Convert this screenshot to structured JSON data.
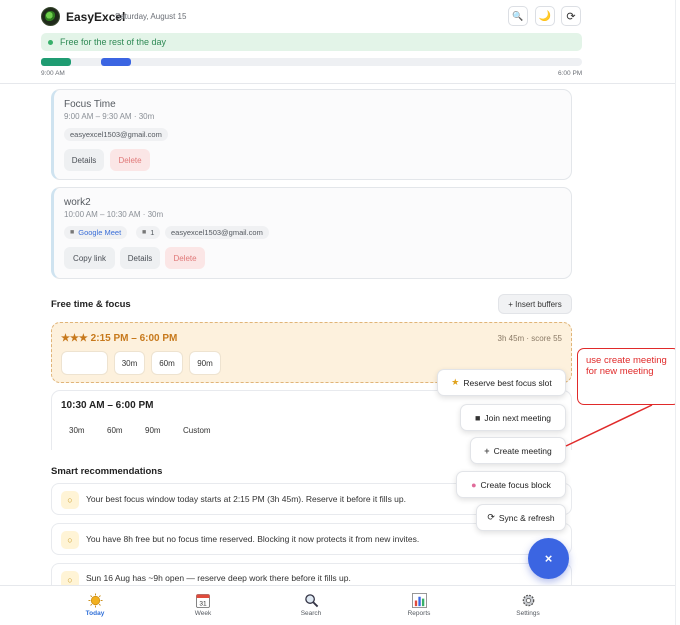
{
  "header": {
    "title": "EasyExcel",
    "date": "Saturday, August 15",
    "buttons": {
      "search_icon": "🔍",
      "theme_icon": "🌙",
      "refresh_icon": "⟳"
    },
    "free_banner": "Free for the rest of the day",
    "timeline": {
      "start": "9:00 AM",
      "end": "6:00 PM"
    }
  },
  "events": [
    {
      "title": "Focus Time",
      "time": "9:00 AM – 9:30 AM · 30m",
      "email": "easyexcel1503@gmail.com",
      "buttons": {
        "details": "Details",
        "delete": "Delete"
      }
    },
    {
      "title": "work2",
      "time": "10:00 AM – 10:30 AM · 30m",
      "meet": "Google Meet",
      "attendees": "1",
      "email": "easyexcel1503@gmail.com",
      "buttons": {
        "copy_link": "Copy link",
        "details": "Details",
        "delete": "Delete"
      }
    }
  ],
  "free_time": {
    "section_title": "Free time & focus",
    "insert_buffers": "+ Insert buffers",
    "best_slot": {
      "time": "★★★ 2:15 PM – 6:00 PM",
      "meta": "3h 45m · score 55",
      "durations": [
        "30m",
        "60m",
        "90m"
      ]
    },
    "slot2": {
      "time": "10:30 AM – 6:00 PM",
      "options": [
        "30m",
        "60m",
        "90m",
        "Custom"
      ]
    }
  },
  "recommendations": {
    "section_title": "Smart recommendations",
    "items": [
      "Your best focus window today starts at 2:15 PM (3h 45m). Reserve it before it fills up.",
      "You have 8h free but no focus time reserved. Blocking it now protects it from new invites.",
      "Sun 16 Aug has ~9h open — reserve deep work there before it fills up."
    ]
  },
  "fab_menu": {
    "reserve": "Reserve best focus slot",
    "join": "Join next meeting",
    "create": "Create meeting",
    "focus_block": "Create focus block",
    "sync": "Sync & refresh",
    "fab_icon": "×"
  },
  "annotation": "use create meeting for new meeting",
  "bottom_nav": [
    {
      "label": "Today",
      "icon": "sun-icon",
      "active": true
    },
    {
      "label": "Week",
      "icon": "calendar-icon",
      "active": false
    },
    {
      "label": "Search",
      "icon": "search-icon",
      "active": false
    },
    {
      "label": "Reports",
      "icon": "bar-chart-icon",
      "active": false
    },
    {
      "label": "Settings",
      "icon": "gear-icon",
      "active": false
    }
  ],
  "colors": {
    "accent": "#3b65e2",
    "timeline_green": "#1f9c72",
    "timeline_blue": "#3b65e2",
    "annotation": "#e02a2a"
  }
}
